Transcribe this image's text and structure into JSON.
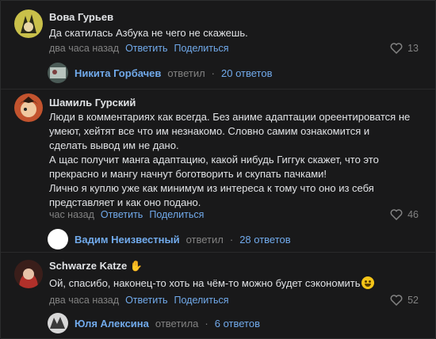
{
  "comments": [
    {
      "author": "Вова Гурьев",
      "text": "Да скатилась Азбука не чего не скажешь.",
      "time": "два часа назад",
      "reply_label": "Ответить",
      "share_label": "Поделиться",
      "likes": "13",
      "replies": {
        "name": "Никита Горбачев",
        "verb": "ответил",
        "dot": "·",
        "count": "20 ответов"
      }
    },
    {
      "author": "Шамиль Гурский",
      "text": "Люди в комментариях как всегда. Без аниме адаптации ореентироватся не\nумеют, хейтят все что им незнакомо. Словно самим ознакомится и\nсделать вывод им не дано.\nА щас получит манга адаптацию, какой нибудь Гиггук скажет, что это\nпрекрасно и мангу начнут боготворить и скупать пачками!\nЛично я куплю уже как минимум из интереса к тому что оно из себя\nпредставляет и как оно подано.",
      "time": "час назад",
      "reply_label": "Ответить",
      "share_label": "Поделиться",
      "likes": "46",
      "replies": {
        "name": "Вадим Неизвестный",
        "verb": "ответил",
        "dot": "·",
        "count": "28 ответов"
      }
    },
    {
      "author": "Schwarze Katze",
      "text": "Ой, спасибо, наконец-то хоть на чём-то можно будет сэкономить",
      "time": "два часа назад",
      "reply_label": "Ответить",
      "share_label": "Поделиться",
      "likes": "52",
      "replies": {
        "name": "Юля Алексина",
        "verb": "ответила",
        "dot": "·",
        "count": "6 ответов"
      }
    }
  ],
  "colors": {
    "background": "#19191a",
    "link": "#71aaeb",
    "muted": "#828282",
    "text": "#e1e3e6"
  }
}
